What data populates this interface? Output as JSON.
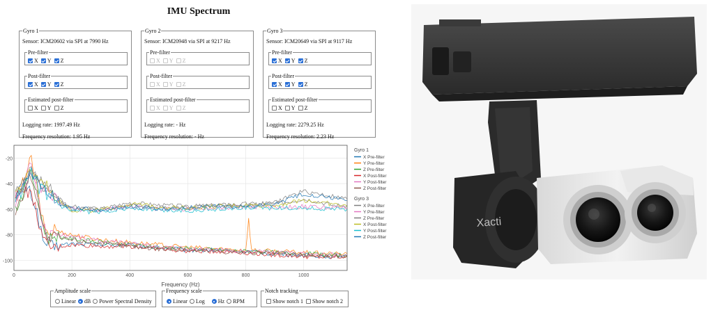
{
  "page": {
    "title": "IMU Spectrum"
  },
  "gyros": [
    {
      "legend": "Gyro 1",
      "sensor": "Sensor: ICM20602 via SPI at 7990 Hz",
      "pre_filter": {
        "legend": "Pre-filter",
        "x": true,
        "y": true,
        "z": true,
        "enabled": true
      },
      "post_filter": {
        "legend": "Post-filter",
        "x": true,
        "y": true,
        "z": true,
        "enabled": true
      },
      "est_post_filter": {
        "legend": "Estimated post-filter",
        "x": false,
        "y": false,
        "z": false,
        "enabled": true
      },
      "logging_rate": "Logging rate: 1997.49 Hz",
      "freq_resolution": "Frequency resolution: 1.95 Hz"
    },
    {
      "legend": "Gyro 2",
      "sensor": "Sensor: ICM20948 via SPI at 9217 Hz",
      "pre_filter": {
        "legend": "Pre-filter",
        "x": false,
        "y": false,
        "z": false,
        "enabled": false
      },
      "post_filter": {
        "legend": "Post-filter",
        "x": false,
        "y": false,
        "z": false,
        "enabled": false
      },
      "est_post_filter": {
        "legend": "Estimated post-filter",
        "x": false,
        "y": false,
        "z": false,
        "enabled": false
      },
      "logging_rate": "Logging rate: - Hz",
      "freq_resolution": "Frequency resolution: - Hz"
    },
    {
      "legend": "Gyro 3",
      "sensor": "Sensor: ICM20649 via SPI at 9117 Hz",
      "pre_filter": {
        "legend": "Pre-filter",
        "x": true,
        "y": true,
        "z": true,
        "enabled": true
      },
      "post_filter": {
        "legend": "Post-filter",
        "x": true,
        "y": true,
        "z": true,
        "enabled": true
      },
      "est_post_filter": {
        "legend": "Estimated post-filter",
        "x": false,
        "y": false,
        "z": false,
        "enabled": true
      },
      "logging_rate": "Logging rate: 2279.25 Hz",
      "freq_resolution": "Frequency resolution: 2.23 Hz"
    }
  ],
  "axis_labels": {
    "x": "X",
    "y": "Y",
    "z": "Z"
  },
  "chart_data": {
    "type": "line",
    "xlabel": "Frequency (Hz)",
    "ylabel": "",
    "xlim": [
      0,
      1150
    ],
    "ylim": [
      -108,
      -10
    ],
    "xticks": [
      0,
      200,
      400,
      600,
      800,
      1000
    ],
    "yticks": [
      -20,
      -40,
      -60,
      -80,
      -100
    ],
    "grid": true,
    "legend_position": "right",
    "legend_groups": [
      {
        "title": "Gyro 1",
        "entries": [
          "X Pre-filter",
          "Y Pre-filter",
          "Z Pre-filter",
          "X Post-filter",
          "Y Post-filter",
          "Z Post-filter"
        ]
      },
      {
        "title": "Gyro 3",
        "entries": [
          "X Pre-filter",
          "Y Pre-filter",
          "Z Pre-filter",
          "X Post-filter",
          "Y Post-filter",
          "Z Post-filter"
        ]
      }
    ],
    "series_colors": [
      "#1f77b4",
      "#ff7f0e",
      "#2ca02c",
      "#d62728",
      "#e377c2",
      "#8c564b",
      "#7f7f7f",
      "#e377c2",
      "#7f7f7f",
      "#bcbd22",
      "#17becf",
      "#1f77b4"
    ],
    "series": [
      {
        "name": "X Pre-filter",
        "group": "Gyro 1",
        "color": "#1f77b4",
        "x": [
          5,
          30,
          60,
          80,
          100,
          120,
          140,
          160,
          200,
          300,
          400,
          500,
          600,
          700,
          800,
          900,
          1000,
          1100,
          1150
        ],
        "y": [
          -50,
          -40,
          -48,
          -62,
          -85,
          -88,
          -90,
          -88,
          -87,
          -88,
          -88,
          -90,
          -92,
          -92,
          -93,
          -95,
          -96,
          -97,
          -96
        ]
      },
      {
        "name": "Y Pre-filter",
        "group": "Gyro 1",
        "color": "#ff7f0e",
        "x": [
          5,
          30,
          60,
          80,
          100,
          120,
          140,
          160,
          200,
          300,
          400,
          500,
          600,
          700,
          800,
          810,
          820,
          900,
          1000,
          1100,
          1150
        ],
        "y": [
          -55,
          -40,
          -20,
          -45,
          -70,
          -80,
          -75,
          -78,
          -80,
          -84,
          -86,
          -88,
          -90,
          -91,
          -92,
          -68,
          -92,
          -93,
          -94,
          -95,
          -95
        ]
      },
      {
        "name": "Z Pre-filter",
        "group": "Gyro 1",
        "color": "#2ca02c",
        "x": [
          5,
          30,
          60,
          80,
          100,
          120,
          140,
          160,
          200,
          300,
          400,
          500,
          600,
          700,
          800,
          900,
          1000,
          1100,
          1150
        ],
        "y": [
          -60,
          -48,
          -30,
          -50,
          -72,
          -84,
          -80,
          -82,
          -83,
          -86,
          -88,
          -90,
          -91,
          -92,
          -93,
          -94,
          -95,
          -96,
          -96
        ]
      },
      {
        "name": "X Post-filter",
        "group": "Gyro 1",
        "color": "#d62728",
        "x": [
          5,
          30,
          60,
          80,
          100,
          120,
          140,
          160,
          200,
          300,
          400,
          500,
          600,
          700,
          800,
          900,
          1000,
          1100,
          1150
        ],
        "y": [
          -52,
          -42,
          -50,
          -64,
          -86,
          -89,
          -91,
          -89,
          -88,
          -89,
          -89,
          -91,
          -93,
          -93,
          -94,
          -96,
          -97,
          -98,
          -97
        ]
      },
      {
        "name": "Y Post-filter",
        "group": "Gyro 1",
        "color": "#e377c2",
        "x": [
          5,
          30,
          60,
          80,
          100,
          120,
          140,
          160,
          200,
          300,
          400,
          500,
          600,
          700,
          800,
          900,
          1000,
          1100,
          1150
        ],
        "y": [
          -57,
          -42,
          -24,
          -47,
          -72,
          -82,
          -77,
          -80,
          -81,
          -85,
          -87,
          -89,
          -91,
          -92,
          -93,
          -94,
          -95,
          -96,
          -96
        ]
      },
      {
        "name": "Z Post-filter",
        "group": "Gyro 1",
        "color": "#8c564b",
        "x": [
          5,
          30,
          60,
          80,
          100,
          120,
          140,
          160,
          200,
          300,
          400,
          500,
          600,
          700,
          800,
          900,
          1000,
          1100,
          1150
        ],
        "y": [
          -62,
          -50,
          -33,
          -52,
          -74,
          -85,
          -82,
          -83,
          -84,
          -87,
          -89,
          -91,
          -92,
          -93,
          -94,
          -95,
          -96,
          -97,
          -97
        ]
      },
      {
        "name": "X Pre-filter",
        "group": "Gyro 3",
        "color": "#7f7f7f",
        "x": [
          5,
          30,
          60,
          80,
          100,
          120,
          140,
          160,
          200,
          300,
          400,
          500,
          600,
          700,
          800,
          900,
          1000,
          1050,
          1100,
          1150
        ],
        "y": [
          -45,
          -42,
          -28,
          -35,
          -38,
          -42,
          -47,
          -52,
          -60,
          -60,
          -55,
          -57,
          -58,
          -57,
          -56,
          -56,
          -52,
          -54,
          -57,
          -57
        ]
      },
      {
        "name": "Y Pre-filter",
        "group": "Gyro 3",
        "color": "#e377c2",
        "x": [
          5,
          30,
          60,
          80,
          100,
          120,
          140,
          160,
          200,
          300,
          400,
          500,
          600,
          700,
          800,
          900,
          1000,
          1100,
          1150
        ],
        "y": [
          -50,
          -44,
          -30,
          -40,
          -44,
          -48,
          -52,
          -56,
          -60,
          -61,
          -58,
          -60,
          -60,
          -59,
          -58,
          -58,
          -58,
          -59,
          -59
        ]
      },
      {
        "name": "Z Pre-filter",
        "group": "Gyro 3",
        "color": "#7f7f7f",
        "x": [
          5,
          30,
          60,
          80,
          100,
          120,
          140,
          160,
          200,
          300,
          400,
          500,
          600,
          700,
          800,
          900,
          950,
          1000,
          1100,
          1150
        ],
        "y": [
          -48,
          -40,
          -32,
          -38,
          -42,
          -47,
          -50,
          -55,
          -58,
          -60,
          -57,
          -59,
          -58,
          -57,
          -57,
          -55,
          -50,
          -46,
          -50,
          -52
        ]
      },
      {
        "name": "X Post-filter",
        "group": "Gyro 3",
        "color": "#bcbd22",
        "x": [
          5,
          30,
          60,
          80,
          100,
          120,
          140,
          160,
          200,
          300,
          400,
          500,
          600,
          700,
          800,
          900,
          1000,
          1100,
          1150
        ],
        "y": [
          -47,
          -43,
          -29,
          -36,
          -39,
          -43,
          -48,
          -53,
          -61,
          -61,
          -56,
          -58,
          -59,
          -58,
          -57,
          -57,
          -53,
          -56,
          -58
        ]
      },
      {
        "name": "Y Post-filter",
        "group": "Gyro 3",
        "color": "#17becf",
        "x": [
          5,
          30,
          60,
          80,
          100,
          120,
          140,
          160,
          200,
          300,
          400,
          500,
          600,
          700,
          800,
          900,
          1000,
          1100,
          1150
        ],
        "y": [
          -52,
          -46,
          -32,
          -42,
          -46,
          -50,
          -54,
          -58,
          -62,
          -62,
          -59,
          -61,
          -61,
          -60,
          -59,
          -59,
          -59,
          -60,
          -60
        ]
      },
      {
        "name": "Z Post-filter",
        "group": "Gyro 3",
        "color": "#1f77b4",
        "x": [
          5,
          30,
          60,
          80,
          100,
          120,
          140,
          160,
          200,
          300,
          400,
          500,
          600,
          700,
          800,
          900,
          1000,
          1100,
          1150
        ],
        "y": [
          -49,
          -41,
          -33,
          -39,
          -43,
          -48,
          -51,
          -56,
          -59,
          -61,
          -58,
          -60,
          -59,
          -58,
          -58,
          -56,
          -48,
          -51,
          -53
        ]
      }
    ]
  },
  "controls": {
    "amplitude": {
      "legend": "Amplitude scale",
      "options": [
        "Linear",
        "dB",
        "Power Spectral Density"
      ],
      "selected": "dB"
    },
    "frequency": {
      "legend": "Frequency scale",
      "scale_options": [
        "Linear",
        "Log"
      ],
      "scale_selected": "Linear",
      "unit_options": [
        "Hz",
        "RPM"
      ],
      "unit_selected": "Hz"
    },
    "notch": {
      "legend": "Notch tracking",
      "options": [
        "Show notch 1",
        "Show notch 2"
      ],
      "checked": [
        false,
        false
      ]
    }
  },
  "photo": {
    "brand": "Xacti"
  }
}
